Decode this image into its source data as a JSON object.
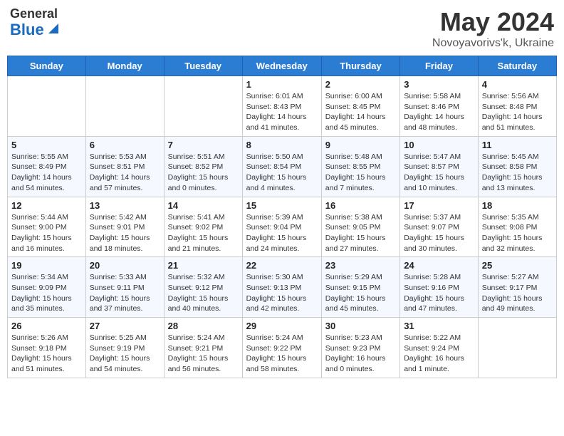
{
  "header": {
    "logo_general": "General",
    "logo_blue": "Blue",
    "month_title": "May 2024",
    "location": "Novoyavorivs'k, Ukraine"
  },
  "days_of_week": [
    "Sunday",
    "Monday",
    "Tuesday",
    "Wednesday",
    "Thursday",
    "Friday",
    "Saturday"
  ],
  "weeks": [
    [
      {
        "day": "",
        "info": ""
      },
      {
        "day": "",
        "info": ""
      },
      {
        "day": "",
        "info": ""
      },
      {
        "day": "1",
        "info": "Sunrise: 6:01 AM\nSunset: 8:43 PM\nDaylight: 14 hours\nand 41 minutes."
      },
      {
        "day": "2",
        "info": "Sunrise: 6:00 AM\nSunset: 8:45 PM\nDaylight: 14 hours\nand 45 minutes."
      },
      {
        "day": "3",
        "info": "Sunrise: 5:58 AM\nSunset: 8:46 PM\nDaylight: 14 hours\nand 48 minutes."
      },
      {
        "day": "4",
        "info": "Sunrise: 5:56 AM\nSunset: 8:48 PM\nDaylight: 14 hours\nand 51 minutes."
      }
    ],
    [
      {
        "day": "5",
        "info": "Sunrise: 5:55 AM\nSunset: 8:49 PM\nDaylight: 14 hours\nand 54 minutes."
      },
      {
        "day": "6",
        "info": "Sunrise: 5:53 AM\nSunset: 8:51 PM\nDaylight: 14 hours\nand 57 minutes."
      },
      {
        "day": "7",
        "info": "Sunrise: 5:51 AM\nSunset: 8:52 PM\nDaylight: 15 hours\nand 0 minutes."
      },
      {
        "day": "8",
        "info": "Sunrise: 5:50 AM\nSunset: 8:54 PM\nDaylight: 15 hours\nand 4 minutes."
      },
      {
        "day": "9",
        "info": "Sunrise: 5:48 AM\nSunset: 8:55 PM\nDaylight: 15 hours\nand 7 minutes."
      },
      {
        "day": "10",
        "info": "Sunrise: 5:47 AM\nSunset: 8:57 PM\nDaylight: 15 hours\nand 10 minutes."
      },
      {
        "day": "11",
        "info": "Sunrise: 5:45 AM\nSunset: 8:58 PM\nDaylight: 15 hours\nand 13 minutes."
      }
    ],
    [
      {
        "day": "12",
        "info": "Sunrise: 5:44 AM\nSunset: 9:00 PM\nDaylight: 15 hours\nand 16 minutes."
      },
      {
        "day": "13",
        "info": "Sunrise: 5:42 AM\nSunset: 9:01 PM\nDaylight: 15 hours\nand 18 minutes."
      },
      {
        "day": "14",
        "info": "Sunrise: 5:41 AM\nSunset: 9:02 PM\nDaylight: 15 hours\nand 21 minutes."
      },
      {
        "day": "15",
        "info": "Sunrise: 5:39 AM\nSunset: 9:04 PM\nDaylight: 15 hours\nand 24 minutes."
      },
      {
        "day": "16",
        "info": "Sunrise: 5:38 AM\nSunset: 9:05 PM\nDaylight: 15 hours\nand 27 minutes."
      },
      {
        "day": "17",
        "info": "Sunrise: 5:37 AM\nSunset: 9:07 PM\nDaylight: 15 hours\nand 30 minutes."
      },
      {
        "day": "18",
        "info": "Sunrise: 5:35 AM\nSunset: 9:08 PM\nDaylight: 15 hours\nand 32 minutes."
      }
    ],
    [
      {
        "day": "19",
        "info": "Sunrise: 5:34 AM\nSunset: 9:09 PM\nDaylight: 15 hours\nand 35 minutes."
      },
      {
        "day": "20",
        "info": "Sunrise: 5:33 AM\nSunset: 9:11 PM\nDaylight: 15 hours\nand 37 minutes."
      },
      {
        "day": "21",
        "info": "Sunrise: 5:32 AM\nSunset: 9:12 PM\nDaylight: 15 hours\nand 40 minutes."
      },
      {
        "day": "22",
        "info": "Sunrise: 5:30 AM\nSunset: 9:13 PM\nDaylight: 15 hours\nand 42 minutes."
      },
      {
        "day": "23",
        "info": "Sunrise: 5:29 AM\nSunset: 9:15 PM\nDaylight: 15 hours\nand 45 minutes."
      },
      {
        "day": "24",
        "info": "Sunrise: 5:28 AM\nSunset: 9:16 PM\nDaylight: 15 hours\nand 47 minutes."
      },
      {
        "day": "25",
        "info": "Sunrise: 5:27 AM\nSunset: 9:17 PM\nDaylight: 15 hours\nand 49 minutes."
      }
    ],
    [
      {
        "day": "26",
        "info": "Sunrise: 5:26 AM\nSunset: 9:18 PM\nDaylight: 15 hours\nand 51 minutes."
      },
      {
        "day": "27",
        "info": "Sunrise: 5:25 AM\nSunset: 9:19 PM\nDaylight: 15 hours\nand 54 minutes."
      },
      {
        "day": "28",
        "info": "Sunrise: 5:24 AM\nSunset: 9:21 PM\nDaylight: 15 hours\nand 56 minutes."
      },
      {
        "day": "29",
        "info": "Sunrise: 5:24 AM\nSunset: 9:22 PM\nDaylight: 15 hours\nand 58 minutes."
      },
      {
        "day": "30",
        "info": "Sunrise: 5:23 AM\nSunset: 9:23 PM\nDaylight: 16 hours\nand 0 minutes."
      },
      {
        "day": "31",
        "info": "Sunrise: 5:22 AM\nSunset: 9:24 PM\nDaylight: 16 hours\nand 1 minute."
      },
      {
        "day": "",
        "info": ""
      }
    ]
  ]
}
